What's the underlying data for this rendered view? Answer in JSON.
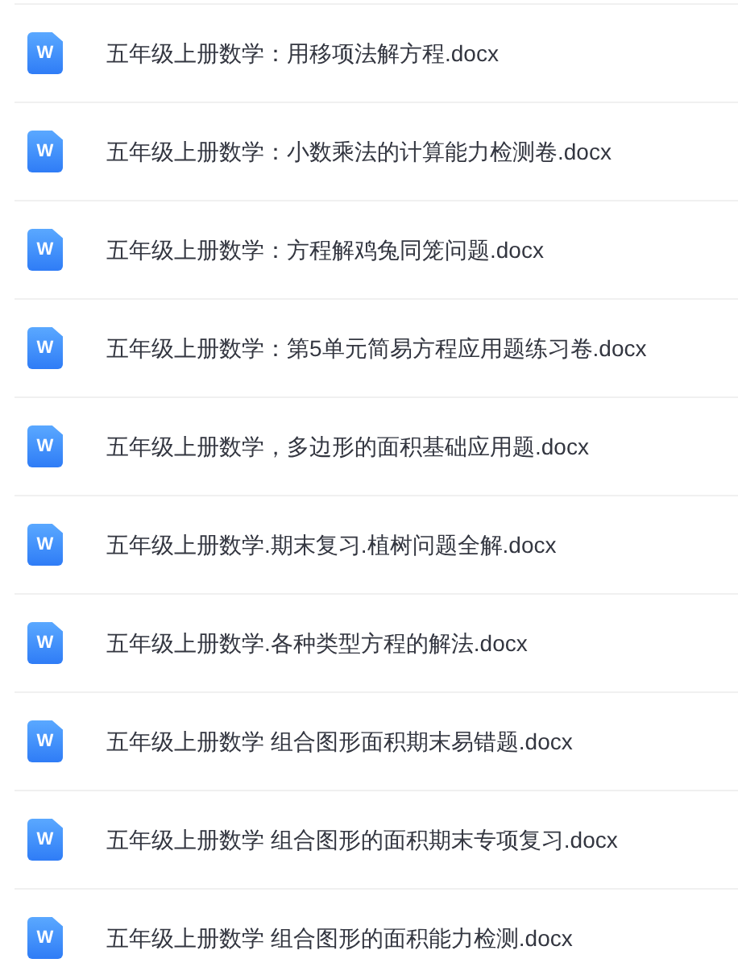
{
  "files": [
    {
      "icon_label": "W",
      "name": "五年级上册数学：用移项法解方程.docx"
    },
    {
      "icon_label": "W",
      "name": "五年级上册数学：小数乘法的计算能力检测卷.docx"
    },
    {
      "icon_label": "W",
      "name": "五年级上册数学：方程解鸡兔同笼问题.docx"
    },
    {
      "icon_label": "W",
      "name": "五年级上册数学：第5单元简易方程应用题练习卷.docx"
    },
    {
      "icon_label": "W",
      "name": "五年级上册数学，多边形的面积基础应用题.docx"
    },
    {
      "icon_label": "W",
      "name": "五年级上册数学.期末复习.植树问题全解.docx"
    },
    {
      "icon_label": "W",
      "name": "五年级上册数学.各种类型方程的解法.docx"
    },
    {
      "icon_label": "W",
      "name": "五年级上册数学 组合图形面积期末易错题.docx"
    },
    {
      "icon_label": "W",
      "name": "五年级上册数学 组合图形的面积期末专项复习.docx"
    },
    {
      "icon_label": "W",
      "name": "五年级上册数学 组合图形的面积能力检测.docx"
    }
  ]
}
